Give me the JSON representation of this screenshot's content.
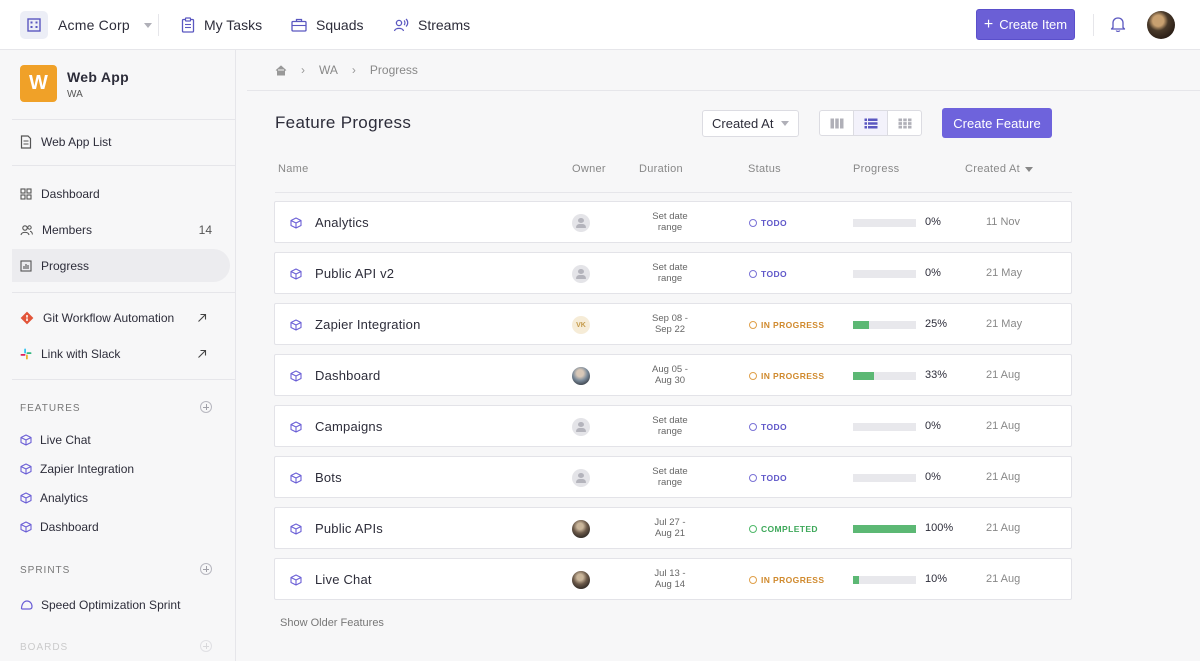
{
  "topbar": {
    "org_name": "Acme Corp",
    "nav": [
      {
        "label": "My Tasks",
        "icon": "clipboard-icon"
      },
      {
        "label": "Squads",
        "icon": "briefcase-icon"
      },
      {
        "label": "Streams",
        "icon": "broadcast-icon"
      }
    ],
    "create_label": "Create Item"
  },
  "sidebar": {
    "app_letter": "W",
    "app_title": "Web App",
    "app_sub": "WA",
    "list_label": "Web App List",
    "items": [
      {
        "label": "Dashboard",
        "icon": "grid-icon"
      },
      {
        "label": "Members",
        "icon": "users-icon",
        "count": "14"
      },
      {
        "label": "Progress",
        "icon": "chart-icon",
        "active": true
      }
    ],
    "integrations": [
      {
        "label": "Git Workflow Automation",
        "icon": "git-icon"
      },
      {
        "label": "Link with Slack",
        "icon": "slack-icon"
      }
    ],
    "features_head": "FEATURES",
    "features": [
      "Live Chat",
      "Zapier Integration",
      "Analytics",
      "Dashboard"
    ],
    "sprints_head": "SPRINTS",
    "sprints": [
      "Speed Optimization Sprint"
    ],
    "boards_head": "BOARDS"
  },
  "breadcrumb": [
    "WA",
    "Progress"
  ],
  "page_title": "Feature Progress",
  "sort_label": "Created At",
  "create_feature_label": "Create Feature",
  "columns": {
    "name": "Name",
    "owner": "Owner",
    "duration": "Duration",
    "status": "Status",
    "progress": "Progress",
    "created": "Created At"
  },
  "features": [
    {
      "name": "Analytics",
      "owner": "",
      "duration": [
        "Set date",
        "range"
      ],
      "status": "TODO",
      "progress": 0,
      "progress_label": "0%",
      "created": "11 Nov"
    },
    {
      "name": "Public API v2",
      "owner": "",
      "duration": [
        "Set date",
        "range"
      ],
      "status": "TODO",
      "progress": 0,
      "progress_label": "0%",
      "created": "21 May"
    },
    {
      "name": "Zapier Integration",
      "owner": "VK",
      "duration": [
        "Sep 08 -",
        "Sep 22"
      ],
      "status": "IN PROGRESS",
      "progress": 25,
      "progress_label": "25%",
      "created": "21 May"
    },
    {
      "name": "Dashboard",
      "owner": "",
      "duration": [
        "Aug 05 -",
        "Aug 30"
      ],
      "status": "IN PROGRESS",
      "progress": 33,
      "progress_label": "33%",
      "created": "21 Aug"
    },
    {
      "name": "Campaigns",
      "owner": "",
      "duration": [
        "Set date",
        "range"
      ],
      "status": "TODO",
      "progress": 0,
      "progress_label": "0%",
      "created": "21 Aug"
    },
    {
      "name": "Bots",
      "owner": "",
      "duration": [
        "Set date",
        "range"
      ],
      "status": "TODO",
      "progress": 0,
      "progress_label": "0%",
      "created": "21 Aug"
    },
    {
      "name": "Public APIs",
      "owner": "",
      "duration": [
        "Jul 27 -",
        "Aug 21"
      ],
      "status": "COMPLETED",
      "progress": 100,
      "progress_label": "100%",
      "created": "21 Aug"
    },
    {
      "name": "Live Chat",
      "owner": "",
      "duration": [
        "Jul 13 -",
        "Aug 14"
      ],
      "status": "IN PROGRESS",
      "progress": 10,
      "progress_label": "10%",
      "created": "21 Aug"
    }
  ],
  "show_older": "Show Older Features",
  "colors": {
    "accent": "#6b5fd6",
    "app_badge": "#f0a128",
    "progress_fill": "#5cb874",
    "todo": "#5f57c9",
    "in_progress": "#d08a2e",
    "completed": "#3ea85a"
  }
}
